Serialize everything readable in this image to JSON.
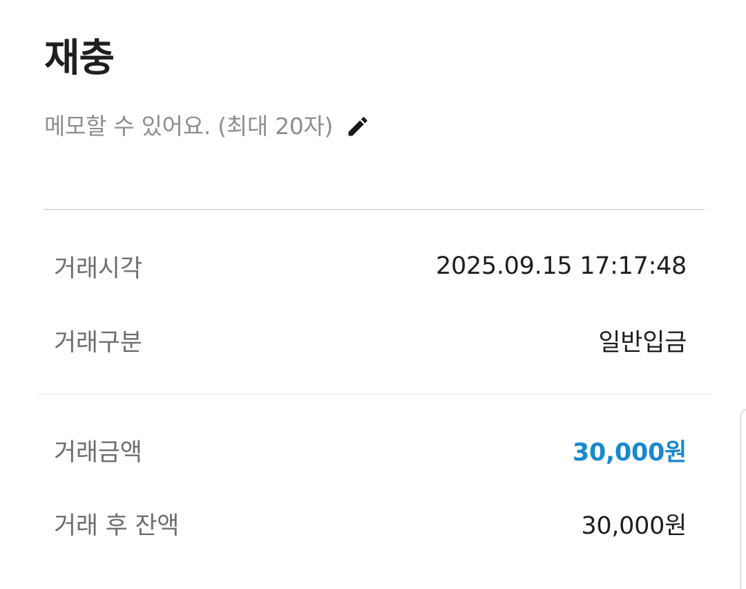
{
  "header": {
    "title": "재충"
  },
  "memo": {
    "placeholder": "메모할 수 있어요. (최대 20자)",
    "icon": "pencil-icon"
  },
  "details": {
    "transaction_time": {
      "label": "거래시각",
      "value": "2025.09.15 17:17:48"
    },
    "transaction_type": {
      "label": "거래구분",
      "value": "일반입금"
    },
    "transaction_amount": {
      "label": "거래금액",
      "value": "30,000원"
    },
    "balance_after": {
      "label": "거래 후 잔액",
      "value": "30,000원"
    }
  },
  "colors": {
    "accent": "#1a88cd",
    "label": "#6e6e6e",
    "muted": "#8d8d8d",
    "text": "#1e1e1e"
  }
}
